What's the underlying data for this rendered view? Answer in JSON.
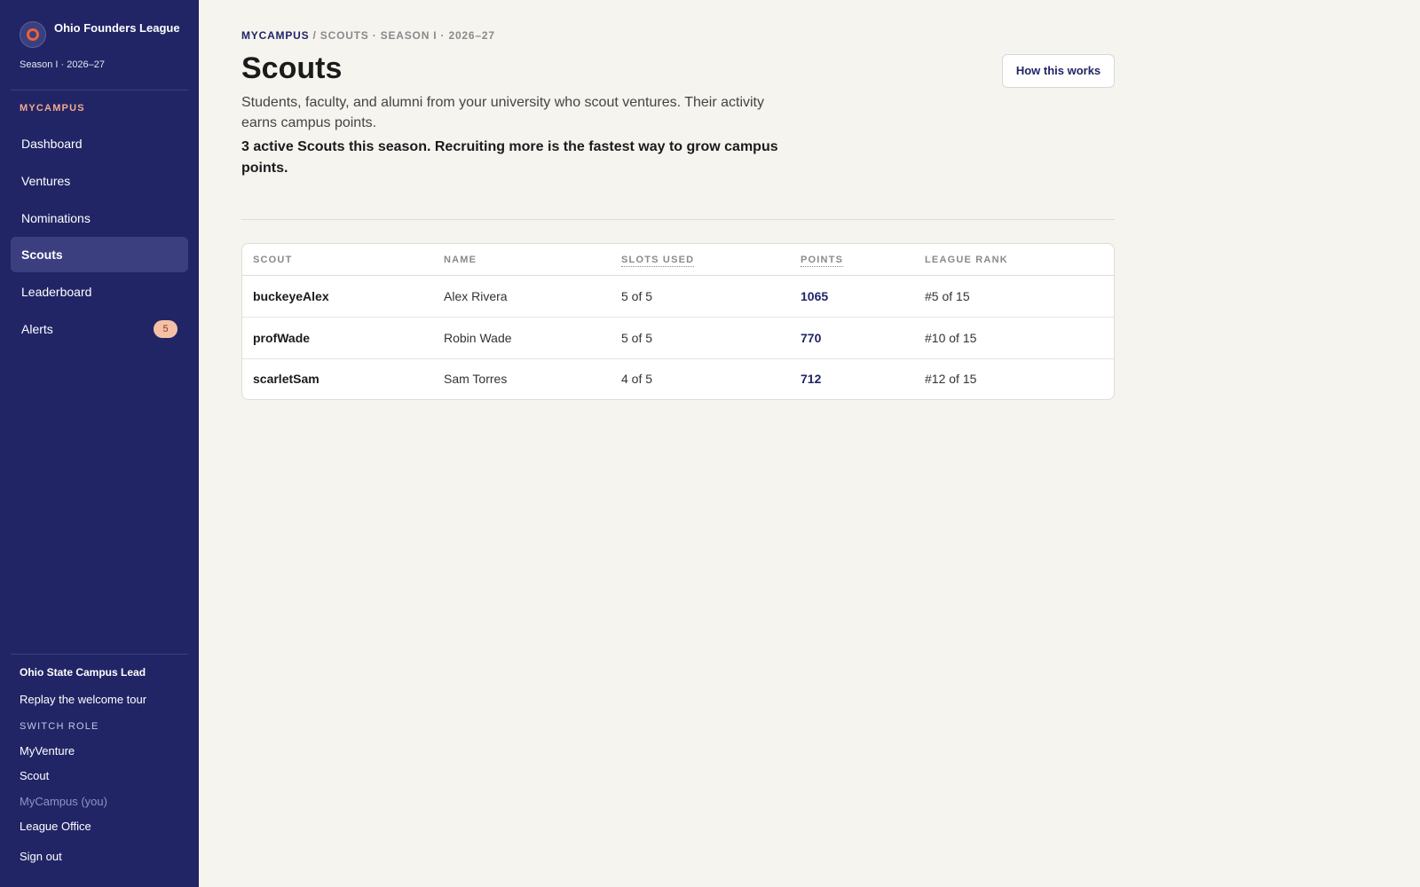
{
  "brand": {
    "name": "Ohio Founders League",
    "season": "Season I · 2026–27"
  },
  "sidebar": {
    "section_label": "MYCAMPUS",
    "nav": [
      {
        "label": "Dashboard",
        "active": false
      },
      {
        "label": "Ventures",
        "active": false
      },
      {
        "label": "Nominations",
        "active": false
      },
      {
        "label": "Scouts",
        "active": true
      },
      {
        "label": "Leaderboard",
        "active": false
      },
      {
        "label": "Alerts",
        "active": false,
        "badge": "5"
      }
    ],
    "role_title": "Ohio State Campus Lead",
    "replay_tour": "Replay the welcome tour",
    "switch_role_label": "SWITCH ROLE",
    "roles": [
      {
        "label": "MyVenture",
        "current": false
      },
      {
        "label": "Scout",
        "current": false
      },
      {
        "label": "MyCampus (you)",
        "current": true
      },
      {
        "label": "League Office",
        "current": false
      }
    ],
    "sign_out": "Sign out"
  },
  "header": {
    "breadcrumb_root": "MYCAMPUS",
    "breadcrumb_rest": " / SCOUTS · SEASON I · 2026–27",
    "title": "Scouts",
    "how_button": "How this works",
    "description": "Students, faculty, and alumni from your university who scout ventures. Their activity earns campus points.",
    "callout": "3 active Scouts this season. Recruiting more is the fastest way to grow campus points."
  },
  "table": {
    "columns": [
      "SCOUT",
      "NAME",
      "SLOTS USED",
      "POINTS",
      "LEAGUE RANK"
    ],
    "rows": [
      {
        "scout": "buckeyeAlex",
        "name": "Alex Rivera",
        "slots": "5 of 5",
        "points": "1065",
        "rank": "#5 of 15"
      },
      {
        "scout": "profWade",
        "name": "Robin Wade",
        "slots": "5 of 5",
        "points": "770",
        "rank": "#10 of 15"
      },
      {
        "scout": "scarletSam",
        "name": "Sam Torres",
        "slots": "4 of 5",
        "points": "712",
        "rank": "#12 of 15"
      }
    ]
  },
  "colors": {
    "sidebar_bg": "#212566",
    "accent_navy": "#212566",
    "accent_orange": "#e8623a",
    "page_bg": "#f5f4ef"
  }
}
